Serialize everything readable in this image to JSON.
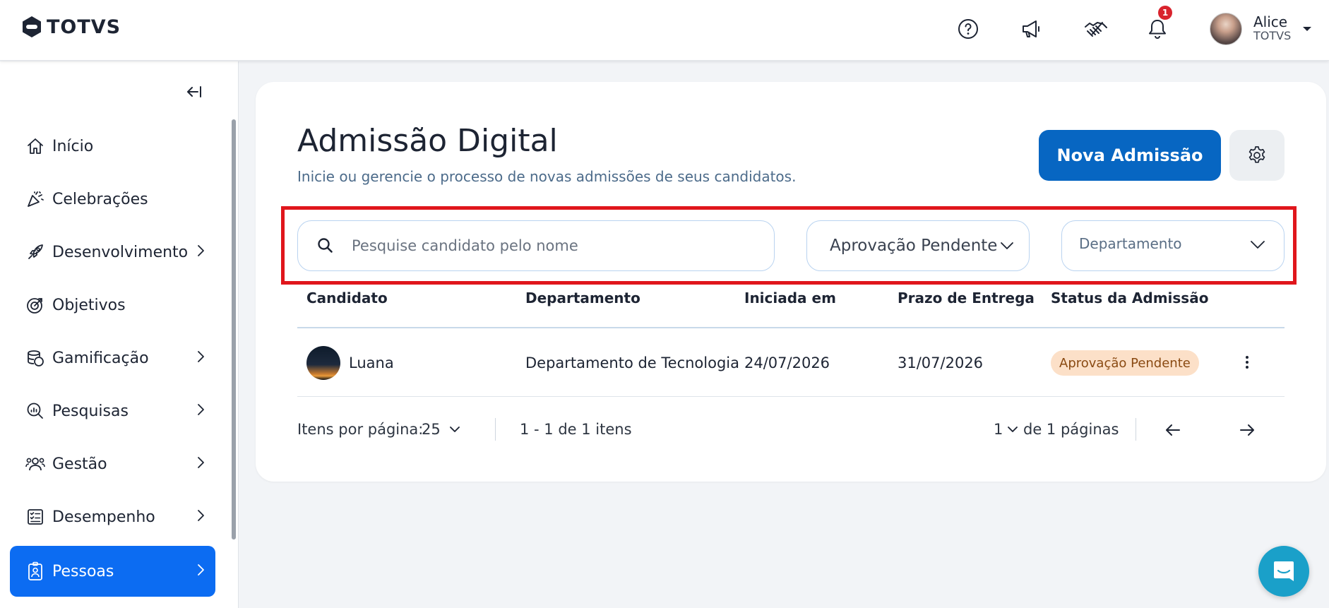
{
  "app": {
    "logo_text": "TOTVS"
  },
  "header": {
    "notification_count": "1",
    "user": {
      "name": "Alice",
      "org": "TOTVS"
    },
    "icons": [
      "help-icon",
      "megaphone-icon",
      "handshake-icon",
      "bell-icon"
    ]
  },
  "sidebar": {
    "items": [
      {
        "label": "Início",
        "icon": "home-icon",
        "has_submenu": false
      },
      {
        "label": "Celebrações",
        "icon": "party-icon",
        "has_submenu": false
      },
      {
        "label": "Desenvolvimento",
        "icon": "rocket-icon",
        "has_submenu": true
      },
      {
        "label": "Objetivos",
        "icon": "target-icon",
        "has_submenu": false
      },
      {
        "label": "Gamificação",
        "icon": "coins-icon",
        "has_submenu": true
      },
      {
        "label": "Pesquisas",
        "icon": "survey-icon",
        "has_submenu": true
      },
      {
        "label": "Gestão",
        "icon": "team-icon",
        "has_submenu": true
      },
      {
        "label": "Desempenho",
        "icon": "checklist-icon",
        "has_submenu": true
      },
      {
        "label": "Pessoas",
        "icon": "badge-icon",
        "has_submenu": true,
        "active": true
      }
    ]
  },
  "page": {
    "title": "Admissão Digital",
    "subtitle": "Inicie ou gerencie o processo de novas admissões de seus candidatos.",
    "primary_button": "Nova Admissão"
  },
  "filters": {
    "search_placeholder": "Pesquise candidato pelo nome",
    "search_value": "",
    "status_selected": "Aprovação Pendente",
    "department_placeholder": "Departamento"
  },
  "table": {
    "columns": [
      "Candidato",
      "Departamento",
      "Iniciada em",
      "Prazo de Entrega",
      "Status da Admissão"
    ],
    "rows": [
      {
        "candidate": "Luana",
        "department": "Departamento de Tecnologia",
        "started": "24/07/2026",
        "deadline": "31/07/2026",
        "status": "Aprovação Pendente"
      }
    ]
  },
  "pagination": {
    "items_per_page_label": "Itens por página:",
    "items_per_page": "25",
    "range_text": "1 - 1 de 1 itens",
    "current_page": "1",
    "pages_text": "de 1 páginas"
  },
  "colors": {
    "primary": "#0766c2",
    "active_nav": "#0c6cf2",
    "highlight_border": "#e0161c",
    "status_badge_bg": "#fce0c8",
    "chat_button": "#1aa0c9"
  }
}
